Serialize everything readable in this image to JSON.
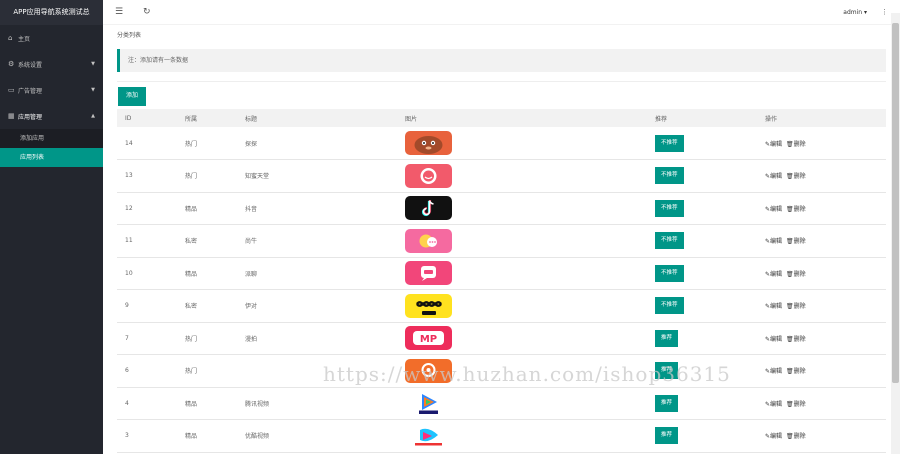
{
  "app_title": "APP应用导航系统测试总",
  "sidebar": {
    "items": [
      {
        "icon": "home-icon",
        "label": "主页",
        "arrow": ""
      },
      {
        "icon": "gear-icon",
        "label": "系统设置",
        "arrow": "▼"
      },
      {
        "icon": "ad-icon",
        "label": "广告管理",
        "arrow": "▼"
      },
      {
        "icon": "app-icon",
        "label": "应用管理",
        "arrow": "▲"
      }
    ],
    "sub_items": [
      {
        "label": "添加应用",
        "active": false
      },
      {
        "label": "应用列表",
        "active": true
      }
    ]
  },
  "topbar": {
    "menu_icon": "menu-icon",
    "refresh_icon": "refresh-icon",
    "user": "admin ▾",
    "more_icon": "more-icon"
  },
  "breadcrumb": "分类列表",
  "notice": "注：添加请有一条数据",
  "add_button": "添加",
  "table": {
    "headers": [
      "ID",
      "所属",
      "标题",
      "图片",
      "推荐",
      "操作"
    ],
    "rows": [
      {
        "id": "14",
        "cat": "热门",
        "title": "探探",
        "icon": "tantan",
        "rec": "不推荐"
      },
      {
        "id": "13",
        "cat": "热门",
        "title": "知蜜天堂",
        "icon": "pink-chat",
        "rec": "不推荐"
      },
      {
        "id": "12",
        "cat": "精品",
        "title": "抖音",
        "icon": "douyin",
        "rec": "不推荐"
      },
      {
        "id": "11",
        "cat": "私密",
        "title": "尚牛",
        "icon": "bubble",
        "rec": "不推荐"
      },
      {
        "id": "10",
        "cat": "精品",
        "title": "派聊",
        "icon": "pink-msg",
        "rec": "不推荐"
      },
      {
        "id": "9",
        "cat": "私密",
        "title": "伊对",
        "icon": "yidui",
        "rec": "不推荐"
      },
      {
        "id": "7",
        "cat": "热门",
        "title": "漫拍",
        "icon": "mp",
        "rec": "推荐"
      },
      {
        "id": "6",
        "cat": "热门",
        "title": "",
        "icon": "orange",
        "rec": "推荐"
      },
      {
        "id": "4",
        "cat": "精品",
        "title": "腾讯视频",
        "icon": "tencent",
        "rec": "推荐"
      },
      {
        "id": "3",
        "cat": "精品",
        "title": "优酷视频",
        "icon": "youku",
        "rec": "推荐"
      }
    ],
    "ops": {
      "edit": "✎编辑",
      "delete": "🗑删除"
    }
  },
  "watermark": "https://www.huzhan.com/ishop36315"
}
